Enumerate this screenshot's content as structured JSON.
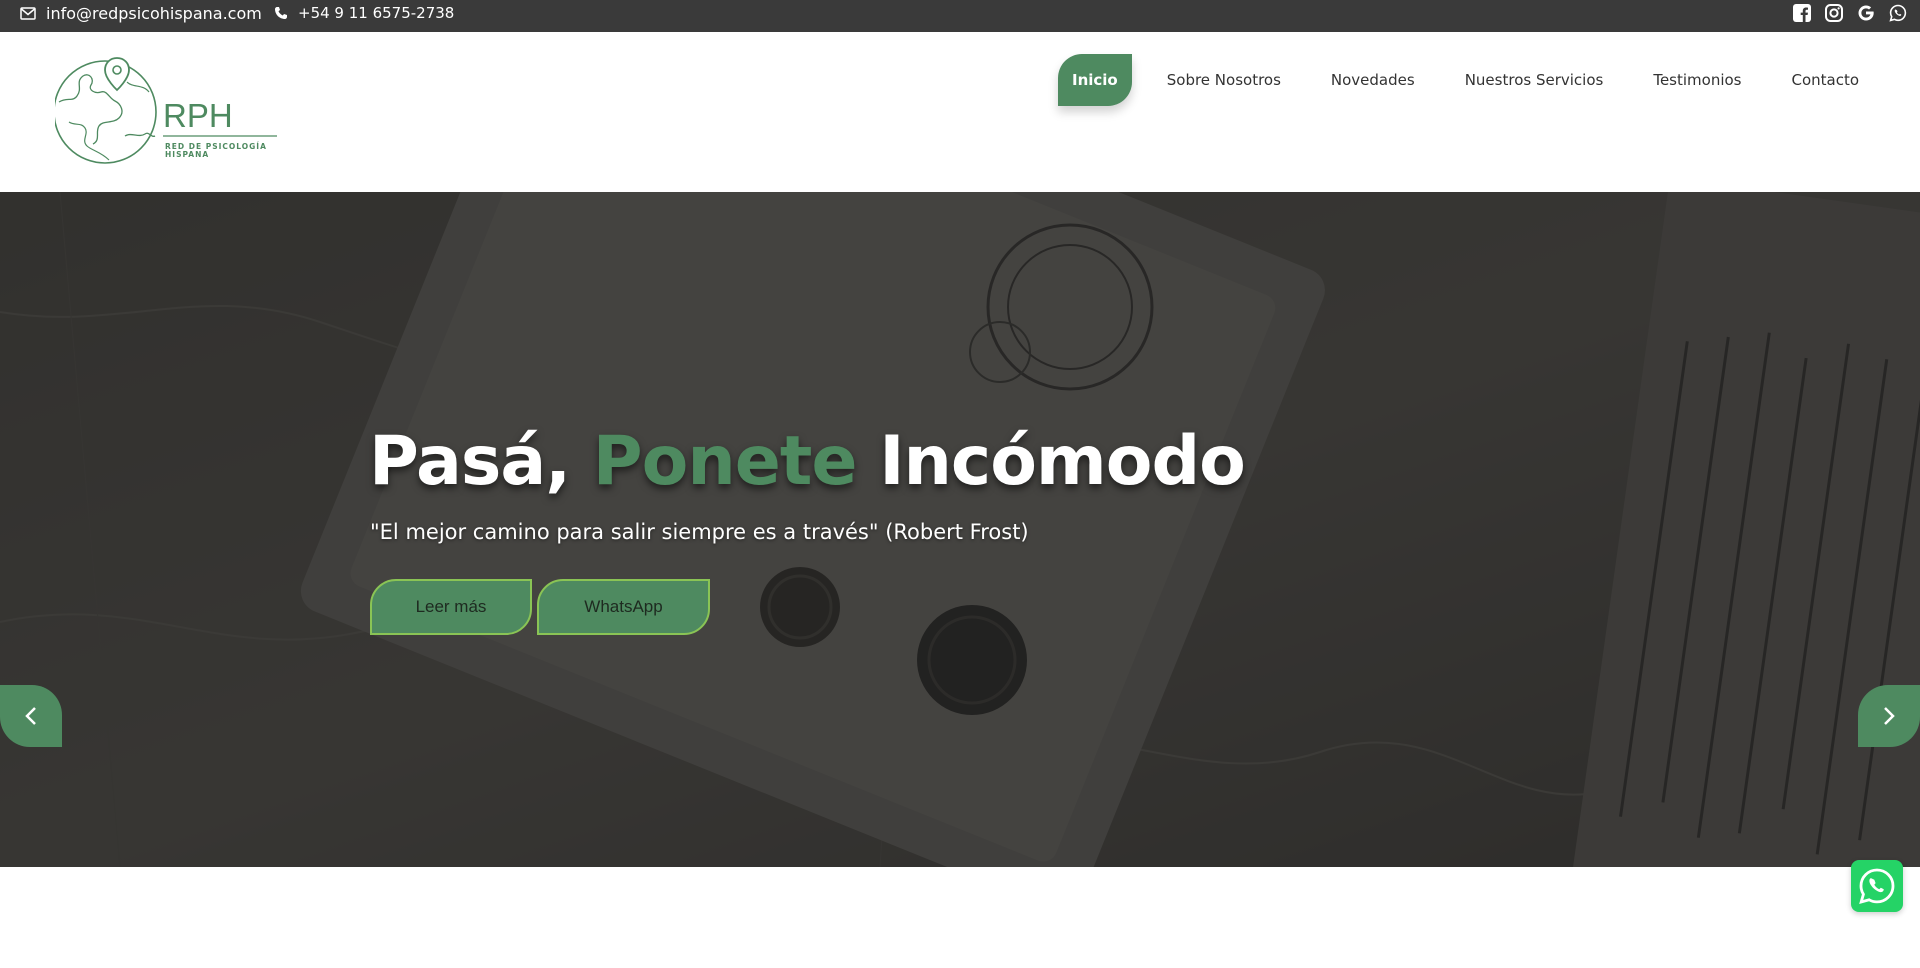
{
  "topbar": {
    "email": "info@redpsicohispana.com",
    "phone": "+54 9 11 6575-2738",
    "email_icon": "envelope-icon",
    "phone_icon": "phone-icon",
    "social": [
      "facebook-icon",
      "instagram-icon",
      "google-icon",
      "whatsapp-icon"
    ]
  },
  "logo": {
    "main": "RPH",
    "line1": "RED DE PSICOLOGÍA",
    "line2": "HISPANA"
  },
  "nav": {
    "items": [
      "Inicio",
      "Sobre Nosotros",
      "Novedades",
      "Nuestros Servicios",
      "Testimonios",
      "Contacto"
    ],
    "active": "Inicio"
  },
  "hero": {
    "title_part1": "Pasá,",
    "title_accent": "Ponete",
    "title_part2": "Incómodo",
    "subtitle": "\"El mejor camino para salir siempre es a través\" (Robert Frost)",
    "btn_primary": "Leer más",
    "btn_secondary": "WhatsApp"
  },
  "colors": {
    "accent": "#4e8a60",
    "topbar": "#3a3a3a",
    "button_border": "#8ac455",
    "whatsapp": "#25d366"
  }
}
